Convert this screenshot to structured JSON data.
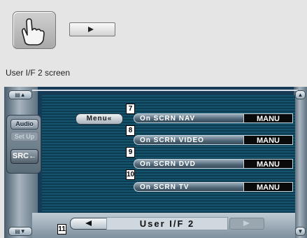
{
  "caption": "User I/F 2 screen",
  "screen": {
    "title": "User  I/F  2",
    "menu_label": "Menu«",
    "side": {
      "audio": "Audio",
      "setup": "Set Up",
      "src": "SRC←"
    },
    "items": [
      {
        "num": "7",
        "label": "On  SCRN  NAV",
        "value": "MANU"
      },
      {
        "num": "8",
        "label": "On  SCRN  VIDEO",
        "value": "MANU"
      },
      {
        "num": "9",
        "label": "On  SCRN  DVD",
        "value": "MANU"
      },
      {
        "num": "10",
        "label": "On  SCRN  TV",
        "value": "MANU"
      }
    ],
    "bottom_num": "11",
    "corner": {
      "tl": "▤▲",
      "tr": "▲",
      "bl": "▤▼",
      "br": "▼"
    }
  }
}
